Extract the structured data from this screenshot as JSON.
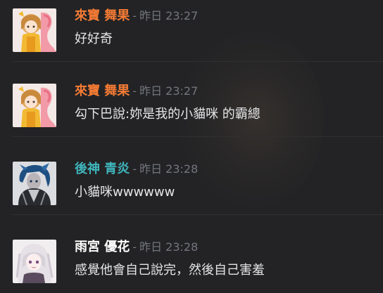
{
  "messages": [
    {
      "author": "來寶 舞果",
      "author_color": "#f47b34",
      "separator": "-",
      "time": "昨日 23:27",
      "text": "好好奇",
      "avatar_icon": "anime-girl-flamingo-avatar"
    },
    {
      "author": "來寶 舞果",
      "author_color": "#f47b34",
      "separator": "-",
      "time": "昨日 23:27",
      "text": "勾下巴說:妳是我的小貓咪 的霸總",
      "avatar_icon": "anime-girl-flamingo-avatar"
    },
    {
      "author": "後神 青炎",
      "author_color": "#3fb6bd",
      "separator": "-",
      "time": "昨日 23:28",
      "text": "小貓咪wwwwww",
      "avatar_icon": "anime-boy-blue-hair-avatar"
    },
    {
      "author": "雨宮 優花",
      "author_color": "#ffffff",
      "separator": "-",
      "time": "昨日 23:28",
      "text": "感覺他會自己說完，然後自己害羞",
      "avatar_icon": "anime-girl-white-hair-avatar"
    }
  ]
}
